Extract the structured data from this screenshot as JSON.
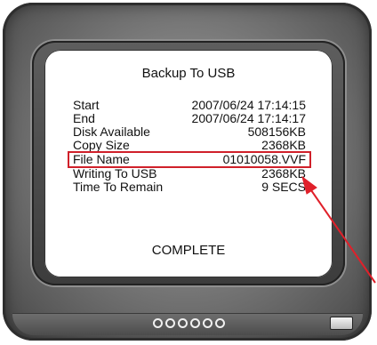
{
  "screen": {
    "title": "Backup To USB",
    "rows": [
      {
        "label": "Start",
        "value": "2007/06/24 17:14:15"
      },
      {
        "label": "End",
        "value": "2007/06/24 17:14:17"
      },
      {
        "label": "Disk Available",
        "value": "508156KB"
      },
      {
        "label": "Copy Size",
        "value": "2368KB"
      },
      {
        "label": "File Name",
        "value": "01010058.VVF"
      },
      {
        "label": "Writing To USB",
        "value": "2368KB"
      },
      {
        "label": "Time To Remain",
        "value": "9 SECS"
      }
    ],
    "status": "COMPLETE"
  },
  "highlight": {
    "row": "File Name",
    "color": "#d0202a"
  },
  "indicators": {
    "count": 6
  }
}
